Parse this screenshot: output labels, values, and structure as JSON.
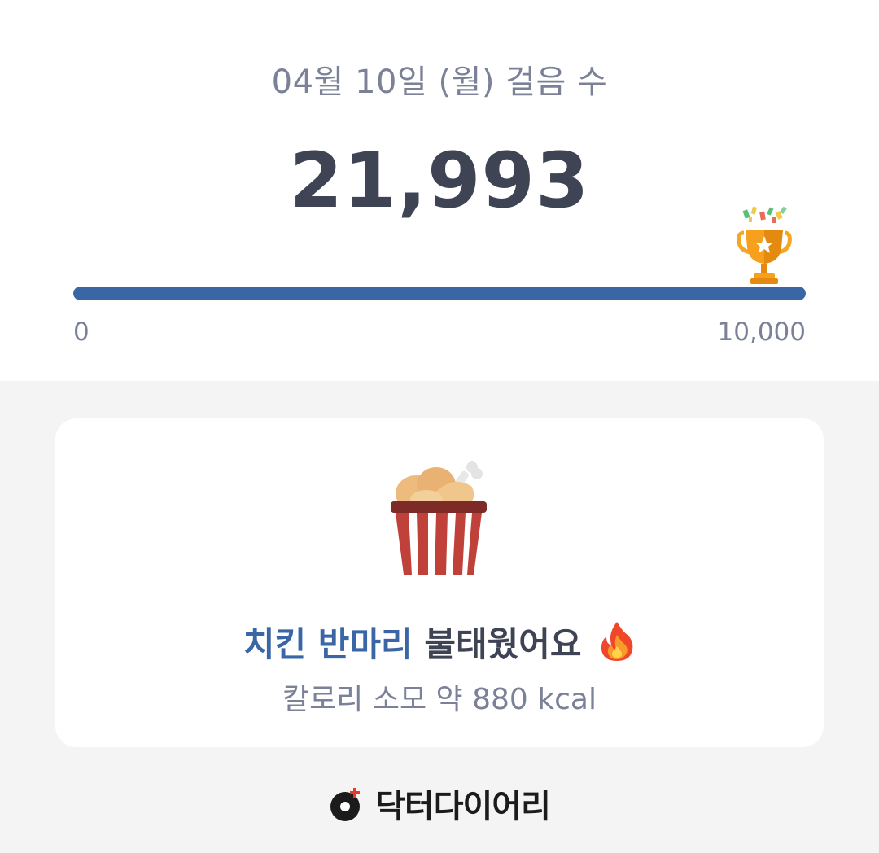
{
  "summary": {
    "date_label": "04월 10일 (월) 걸음 수",
    "step_count": "21,993"
  },
  "progress": {
    "min_label": "0",
    "max_label": "10,000",
    "fill_fraction": 1.0,
    "fill_color": "#3b66a6",
    "goal_icon": "trophy-icon"
  },
  "calorie_card": {
    "food_icon": "fried-chicken-bucket-icon",
    "headline_accent": "치킨 반마리",
    "headline_rest": "불태웠어요",
    "headline_icon": "fire-icon",
    "kcal_text": "칼로리 소모 약 880 kcal"
  },
  "footer": {
    "logo_icon": "doctor-diary-logo-icon",
    "brand_name": "닥터다이어리"
  }
}
